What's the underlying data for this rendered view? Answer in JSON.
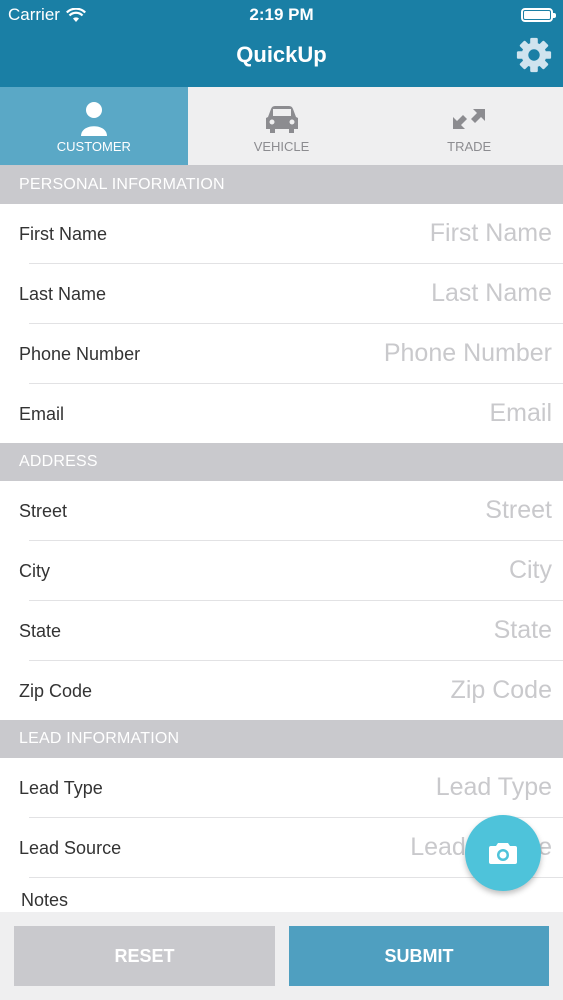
{
  "status_bar": {
    "carrier": "Carrier",
    "time": "2:19 PM"
  },
  "header": {
    "title": "QuickUp",
    "settings_icon": "gear-icon"
  },
  "tabs": [
    {
      "label": "CUSTOMER",
      "icon": "person-icon",
      "active": true
    },
    {
      "label": "VEHICLE",
      "icon": "car-icon",
      "active": false
    },
    {
      "label": "TRADE",
      "icon": "trade-arrows-icon",
      "active": false
    }
  ],
  "sections": {
    "personal": {
      "title": "PERSONAL INFORMATION",
      "fields": [
        {
          "label": "First Name",
          "placeholder": "First Name",
          "value": ""
        },
        {
          "label": "Last Name",
          "placeholder": "Last Name",
          "value": ""
        },
        {
          "label": "Phone Number",
          "placeholder": "Phone Number",
          "value": ""
        },
        {
          "label": "Email",
          "placeholder": "Email",
          "value": ""
        }
      ]
    },
    "address": {
      "title": "ADDRESS",
      "fields": [
        {
          "label": "Street",
          "placeholder": "Street",
          "value": ""
        },
        {
          "label": "City",
          "placeholder": "City",
          "value": ""
        },
        {
          "label": "State",
          "placeholder": "State",
          "value": ""
        },
        {
          "label": "Zip Code",
          "placeholder": "Zip Code",
          "value": ""
        }
      ]
    },
    "lead": {
      "title": "LEAD INFORMATION",
      "fields": [
        {
          "label": "Lead Type",
          "placeholder": "Lead Type",
          "value": ""
        },
        {
          "label": "Lead Source",
          "placeholder": "Lead Source",
          "value": ""
        }
      ],
      "notes_label": "Notes"
    }
  },
  "footer": {
    "reset_label": "RESET",
    "submit_label": "SUBMIT"
  },
  "fab": {
    "icon": "camera-icon"
  },
  "colors": {
    "header": "#1a7fa5",
    "active_tab": "#5aa8c6",
    "section": "#c9c9cd",
    "submit": "#4f9fc0",
    "fab": "#4ec3da"
  }
}
